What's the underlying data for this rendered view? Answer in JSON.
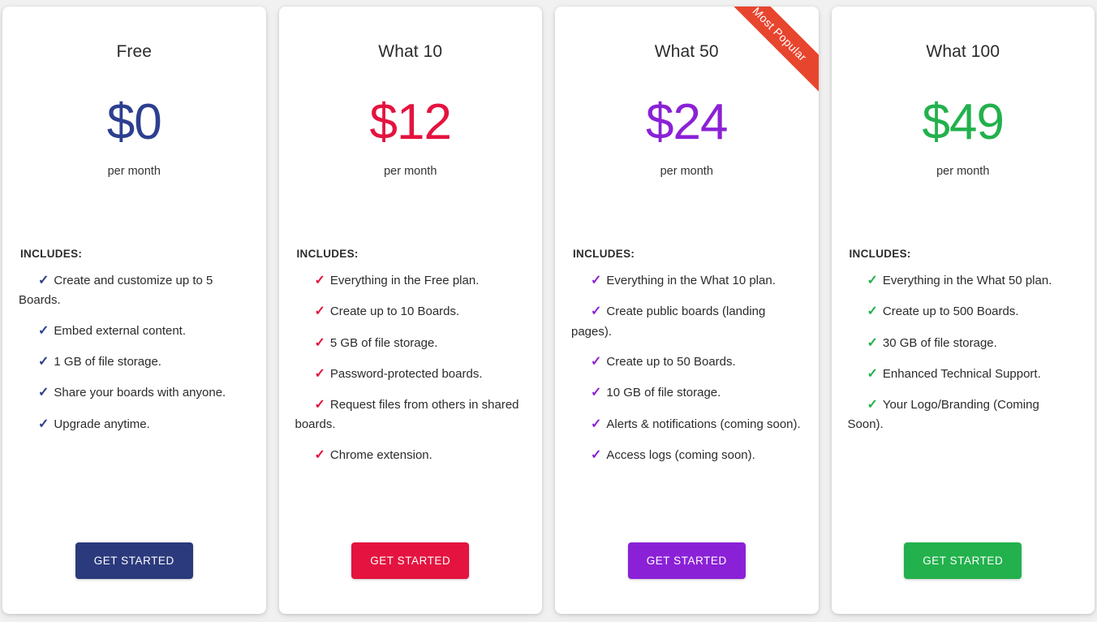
{
  "page": {
    "background_color": "#f1f1f1",
    "includes_label": "INCLUDES:",
    "check_icon": "✓"
  },
  "plans": [
    {
      "name": "Free",
      "price": "$0",
      "period": "per month",
      "accent_color": "#2d3f8f",
      "button_color": "#2b3a7c",
      "cta_label": "GET STARTED",
      "ribbon": null,
      "features": [
        "Create and customize up to 5 Boards.",
        "Embed external content.",
        "1 GB of file storage.",
        "Share your boards with anyone.",
        "Upgrade anytime."
      ]
    },
    {
      "name": "What 10",
      "price": "$12",
      "period": "per month",
      "accent_color": "#e4133f",
      "button_color": "#e4133f",
      "cta_label": "GET STARTED",
      "ribbon": null,
      "features": [
        "Everything in the Free plan.",
        "Create up to 10 Boards.",
        "5 GB of file storage.",
        "Password-protected boards.",
        "Request files from others in shared boards.",
        "Chrome extension."
      ]
    },
    {
      "name": "What 50",
      "price": "$24",
      "period": "per month",
      "accent_color": "#8b21d6",
      "button_color": "#8b21d6",
      "cta_label": "GET STARTED",
      "ribbon": {
        "label": "Most Popular",
        "color": "#e8452e"
      },
      "features": [
        "Everything in the What 10 plan.",
        "Create public boards (landing pages).",
        "Create up to 50 Boards.",
        "10 GB of file storage.",
        "Alerts & notifications (coming soon).",
        "Access logs (coming soon)."
      ]
    },
    {
      "name": "What 100",
      "price": "$49",
      "period": "per month",
      "accent_color": "#22b14c",
      "button_color": "#22b14c",
      "cta_label": "GET STARTED",
      "ribbon": null,
      "features": [
        "Everything in the What 50 plan.",
        "Create up to 500 Boards.",
        "30 GB of file storage.",
        "Enhanced Technical Support.",
        "Your Logo/Branding (Coming Soon)."
      ]
    }
  ]
}
